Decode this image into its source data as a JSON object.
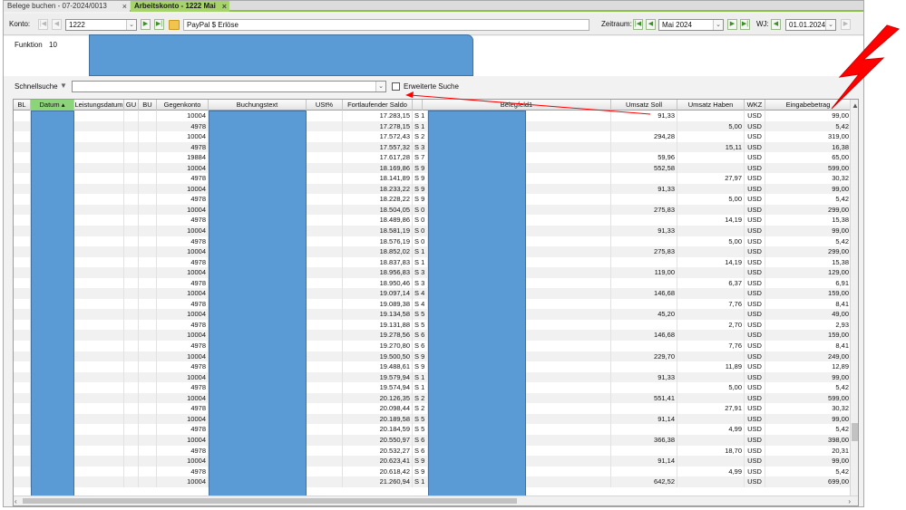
{
  "tabs": [
    {
      "label": "Belege buchen - 07-2024/0013",
      "close": "×"
    },
    {
      "label": "Arbeitskonto - 1222 Mai",
      "close": "×"
    }
  ],
  "toolbar": {
    "konto_label": "Konto:",
    "konto_value": "1222",
    "konto_desc": "PayPal $ Erlöse",
    "zeitraum_label": "Zeitraum:",
    "zeitraum_value": "Mai 2024",
    "wj_label": "WJ:",
    "wj_value": "01.01.2024"
  },
  "funktion": {
    "label": "Funktion",
    "value": "10"
  },
  "search": {
    "label": "Schnellsuche",
    "value": "",
    "extended_label": "Erweiterte Suche"
  },
  "columns": {
    "bl": "BL",
    "datum": "Datum",
    "leistungsdatum": "Leistungsdatum",
    "gu": "GU",
    "bu": "BU",
    "gegenkonto": "Gegenkonto",
    "buchungstext": "Buchungstext",
    "ust": "USt%",
    "saldo": "Fortlaufender Saldo",
    "belegfeld": "Belegfeld1",
    "soll": "Umsatz Soll",
    "haben": "Umsatz Haben",
    "wkz": "WKZ",
    "eingabe": "Eingabebetrag"
  },
  "colors": {
    "accent_green": "#8cd47a",
    "redaction_blue": "#5b9bd5",
    "annotation_red": "#ff0000"
  },
  "rows": [
    {
      "gegenkonto": "10004",
      "saldo": "17.283,15",
      "sh": "S 1",
      "soll": "91,33",
      "haben": "",
      "wkz": "USD",
      "eingabe": "99,00"
    },
    {
      "gegenkonto": "4978",
      "saldo": "17.278,15",
      "sh": "S 1",
      "soll": "",
      "haben": "5,00",
      "wkz": "USD",
      "eingabe": "5,42"
    },
    {
      "gegenkonto": "10004",
      "saldo": "17.572,43",
      "sh": "S 2",
      "soll": "294,28",
      "haben": "",
      "wkz": "USD",
      "eingabe": "319,00"
    },
    {
      "gegenkonto": "4978",
      "saldo": "17.557,32",
      "sh": "S 3",
      "soll": "",
      "haben": "15,11",
      "wkz": "USD",
      "eingabe": "16,38"
    },
    {
      "gegenkonto": "19884",
      "saldo": "17.617,28",
      "sh": "S 7",
      "soll": "59,96",
      "haben": "",
      "wkz": "USD",
      "eingabe": "65,00"
    },
    {
      "gegenkonto": "10004",
      "saldo": "18.169,86",
      "sh": "S 9",
      "soll": "552,58",
      "haben": "",
      "wkz": "USD",
      "eingabe": "599,00"
    },
    {
      "gegenkonto": "4978",
      "saldo": "18.141,89",
      "sh": "S 9",
      "soll": "",
      "haben": "27,97",
      "wkz": "USD",
      "eingabe": "30,32"
    },
    {
      "gegenkonto": "10004",
      "saldo": "18.233,22",
      "sh": "S 9",
      "soll": "91,33",
      "haben": "",
      "wkz": "USD",
      "eingabe": "99,00"
    },
    {
      "gegenkonto": "4978",
      "saldo": "18.228,22",
      "sh": "S 9",
      "soll": "",
      "haben": "5,00",
      "wkz": "USD",
      "eingabe": "5,42"
    },
    {
      "gegenkonto": "10004",
      "saldo": "18.504,05",
      "sh": "S 0",
      "soll": "275,83",
      "haben": "",
      "wkz": "USD",
      "eingabe": "299,00"
    },
    {
      "gegenkonto": "4978",
      "saldo": "18.489,86",
      "sh": "S 0",
      "soll": "",
      "haben": "14,19",
      "wkz": "USD",
      "eingabe": "15,38"
    },
    {
      "gegenkonto": "10004",
      "saldo": "18.581,19",
      "sh": "S 0",
      "soll": "91,33",
      "haben": "",
      "wkz": "USD",
      "eingabe": "99,00"
    },
    {
      "gegenkonto": "4978",
      "saldo": "18.576,19",
      "sh": "S 0",
      "soll": "",
      "haben": "5,00",
      "wkz": "USD",
      "eingabe": "5,42"
    },
    {
      "gegenkonto": "10004",
      "saldo": "18.852,02",
      "sh": "S 1",
      "soll": "275,83",
      "haben": "",
      "wkz": "USD",
      "eingabe": "299,00"
    },
    {
      "gegenkonto": "4978",
      "saldo": "18.837,83",
      "sh": "S 1",
      "soll": "",
      "haben": "14,19",
      "wkz": "USD",
      "eingabe": "15,38"
    },
    {
      "gegenkonto": "10004",
      "saldo": "18.956,83",
      "sh": "S 3",
      "soll": "119,00",
      "haben": "",
      "wkz": "USD",
      "eingabe": "129,00"
    },
    {
      "gegenkonto": "4978",
      "saldo": "18.950,46",
      "sh": "S 3",
      "soll": "",
      "haben": "6,37",
      "wkz": "USD",
      "eingabe": "6,91"
    },
    {
      "gegenkonto": "10004",
      "saldo": "19.097,14",
      "sh": "S 4",
      "soll": "146,68",
      "haben": "",
      "wkz": "USD",
      "eingabe": "159,00"
    },
    {
      "gegenkonto": "4978",
      "saldo": "19.089,38",
      "sh": "S 4",
      "soll": "",
      "haben": "7,76",
      "wkz": "USD",
      "eingabe": "8,41"
    },
    {
      "gegenkonto": "10004",
      "saldo": "19.134,58",
      "sh": "S 5",
      "soll": "45,20",
      "haben": "",
      "wkz": "USD",
      "eingabe": "49,00"
    },
    {
      "gegenkonto": "4978",
      "saldo": "19.131,88",
      "sh": "S 5",
      "soll": "",
      "haben": "2,70",
      "wkz": "USD",
      "eingabe": "2,93"
    },
    {
      "gegenkonto": "10004",
      "saldo": "19.278,56",
      "sh": "S 6",
      "soll": "146,68",
      "haben": "",
      "wkz": "USD",
      "eingabe": "159,00"
    },
    {
      "gegenkonto": "4978",
      "saldo": "19.270,80",
      "sh": "S 6",
      "soll": "",
      "haben": "7,76",
      "wkz": "USD",
      "eingabe": "8,41"
    },
    {
      "gegenkonto": "10004",
      "saldo": "19.500,50",
      "sh": "S 9",
      "soll": "229,70",
      "haben": "",
      "wkz": "USD",
      "eingabe": "249,00"
    },
    {
      "gegenkonto": "4978",
      "saldo": "19.488,61",
      "sh": "S 9",
      "soll": "",
      "haben": "11,89",
      "wkz": "USD",
      "eingabe": "12,89"
    },
    {
      "gegenkonto": "10004",
      "saldo": "19.579,94",
      "sh": "S 1",
      "soll": "91,33",
      "haben": "",
      "wkz": "USD",
      "eingabe": "99,00"
    },
    {
      "gegenkonto": "4978",
      "saldo": "19.574,94",
      "sh": "S 1",
      "soll": "",
      "haben": "5,00",
      "wkz": "USD",
      "eingabe": "5,42"
    },
    {
      "gegenkonto": "10004",
      "saldo": "20.126,35",
      "sh": "S 2",
      "soll": "551,41",
      "haben": "",
      "wkz": "USD",
      "eingabe": "599,00"
    },
    {
      "gegenkonto": "4978",
      "saldo": "20.098,44",
      "sh": "S 2",
      "soll": "",
      "haben": "27,91",
      "wkz": "USD",
      "eingabe": "30,32"
    },
    {
      "gegenkonto": "10004",
      "saldo": "20.189,58",
      "sh": "S 5",
      "soll": "91,14",
      "haben": "",
      "wkz": "USD",
      "eingabe": "99,00"
    },
    {
      "gegenkonto": "4978",
      "saldo": "20.184,59",
      "sh": "S 5",
      "soll": "",
      "haben": "4,99",
      "wkz": "USD",
      "eingabe": "5,42"
    },
    {
      "gegenkonto": "10004",
      "saldo": "20.550,97",
      "sh": "S 6",
      "soll": "366,38",
      "haben": "",
      "wkz": "USD",
      "eingabe": "398,00"
    },
    {
      "gegenkonto": "4978",
      "saldo": "20.532,27",
      "sh": "S 6",
      "soll": "",
      "haben": "18,70",
      "wkz": "USD",
      "eingabe": "20,31"
    },
    {
      "gegenkonto": "10004",
      "saldo": "20.623,41",
      "sh": "S 9",
      "soll": "91,14",
      "haben": "",
      "wkz": "USD",
      "eingabe": "99,00"
    },
    {
      "gegenkonto": "4978",
      "saldo": "20.618,42",
      "sh": "S 9",
      "soll": "",
      "haben": "4,99",
      "wkz": "USD",
      "eingabe": "5,42"
    },
    {
      "gegenkonto": "10004",
      "saldo": "21.260,94",
      "sh": "S 1",
      "soll": "642,52",
      "haben": "",
      "wkz": "USD",
      "eingabe": "699,00"
    }
  ]
}
